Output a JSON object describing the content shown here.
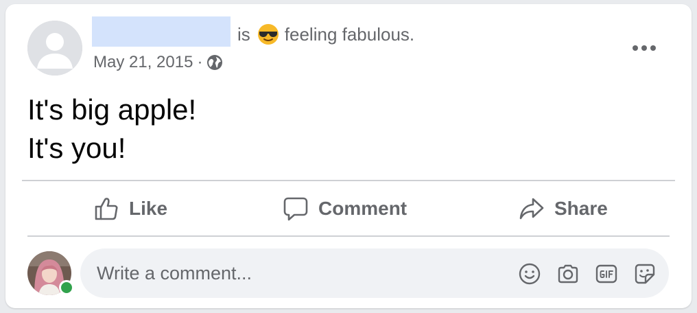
{
  "post": {
    "author_name": "",
    "activity_verb": "is",
    "feeling_text": "feeling fabulous.",
    "feeling_emoji": "sunglasses-emoji",
    "date": "May 21, 2015",
    "separator": "·",
    "privacy_icon": "globe-icon",
    "more_icon": "ellipsis-icon",
    "body_lines": [
      "It's big apple!",
      "It's you!"
    ]
  },
  "actions": {
    "like_label": "Like",
    "comment_label": "Comment",
    "share_label": "Share"
  },
  "composer": {
    "placeholder": "Write a comment...",
    "online_status_color": "#31a24c",
    "icons": [
      "smiley-icon",
      "camera-icon",
      "gif-icon",
      "sticker-icon"
    ]
  },
  "colors": {
    "secondary_text": "#65676b",
    "primary_text": "#050505",
    "divider": "#ced0d4",
    "composer_bg": "#f0f2f5",
    "redaction": "#d4e3fc"
  }
}
